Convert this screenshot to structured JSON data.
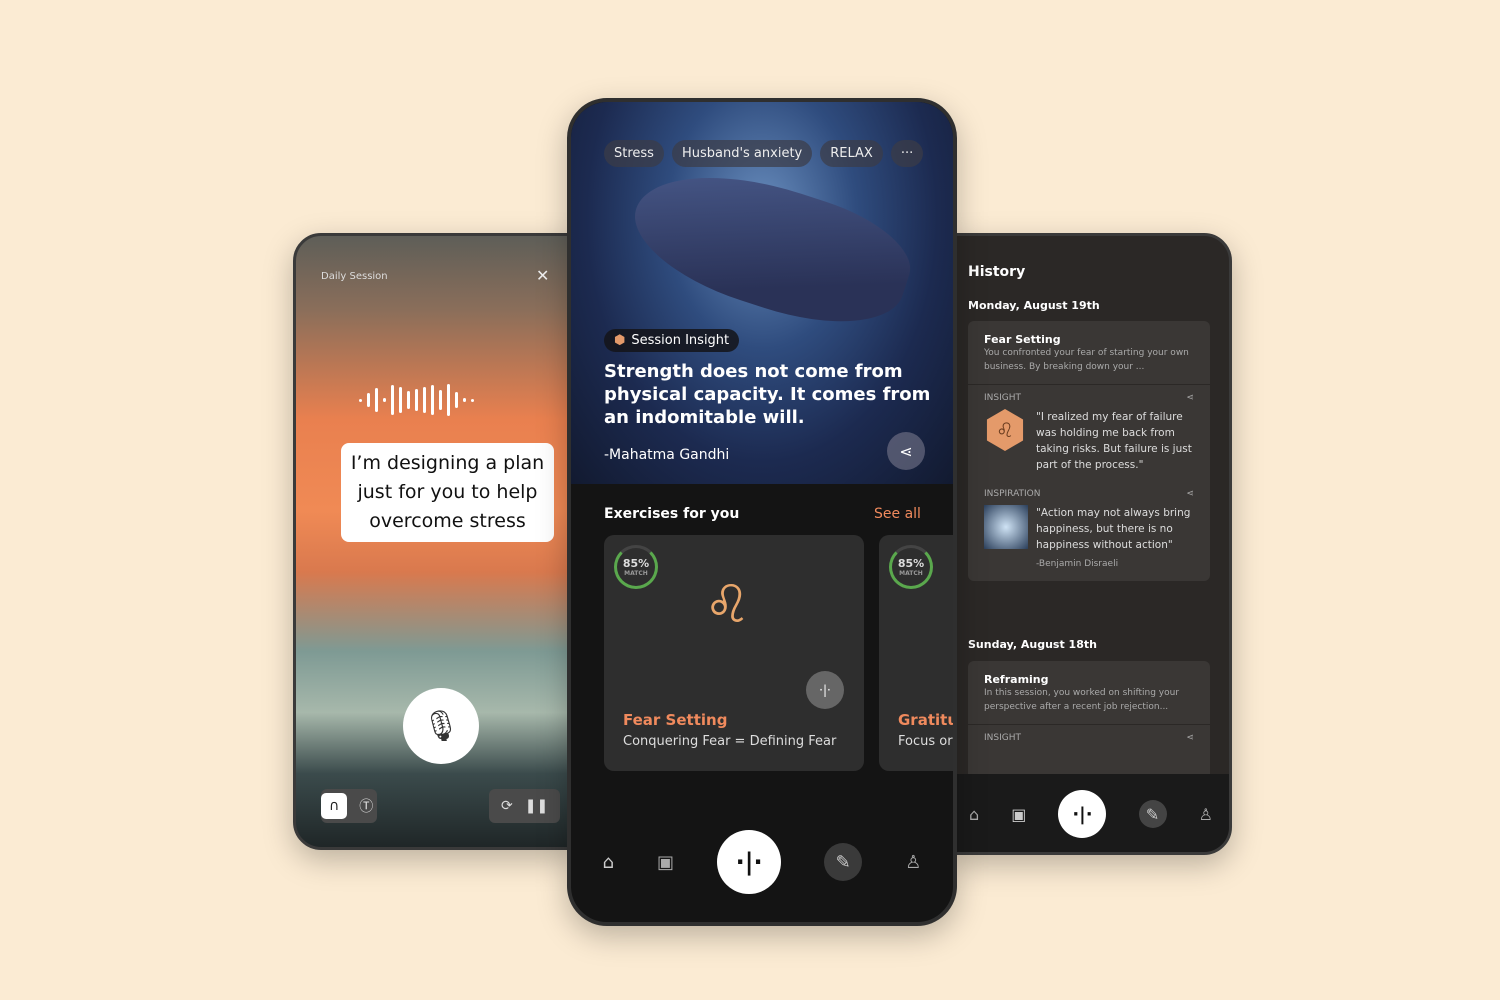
{
  "left": {
    "title": "Daily Session",
    "close_icon": "close-icon",
    "caption": "I’m designing a plan just for you to help overcome stress",
    "icons": [
      "headphones-icon",
      "text-icon",
      "refresh-icon",
      "pause-icon",
      "mic-icon"
    ]
  },
  "middle": {
    "tags": [
      "Stress",
      "Husband's anxiety",
      "RELAX",
      "···"
    ],
    "badge": "Session Insight",
    "quote": "Strength does not come from physical capacity. It comes from an indomitable will.",
    "author": "-Mahatma Gandhi",
    "section_title": "Exercises for you",
    "see_all": "See all",
    "accent": "#f08a5d",
    "cards": [
      {
        "match": "85%",
        "match_label": "MATCH",
        "title": "Fear Setting",
        "subtitle": "Conquering Fear = Defining Fear"
      },
      {
        "match": "85%",
        "match_label": "MATCH",
        "title": "Gratitu",
        "subtitle": "Focus or"
      }
    ],
    "nav": [
      "home-icon",
      "calendar-icon",
      "voice-icon",
      "journal-icon",
      "profile-icon"
    ]
  },
  "right": {
    "title": "History",
    "days": [
      {
        "date": "Monday, August 19th",
        "session": "Fear Setting",
        "summary": "You confronted your fear of starting your own business. By breaking down your ...",
        "insight_label": "INSIGHT",
        "insight": "\"I realized my fear of failure was holding me back from taking risks. But failure is just part of the process.\"",
        "inspiration_label": "INSPIRATION",
        "inspiration": "\"Action may not always bring happiness, but there is no happiness without action\"",
        "inspiration_author": "-Benjamin Disraeli"
      },
      {
        "date": "Sunday, August 18th",
        "session": "Reframing",
        "summary": "In this session, you worked on shifting your perspective after a recent job rejection...",
        "insight_label": "INSIGHT"
      }
    ]
  }
}
